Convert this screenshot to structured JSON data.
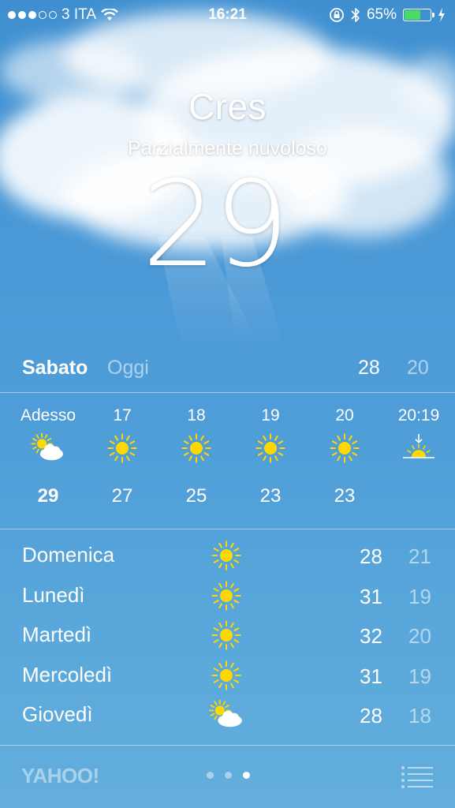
{
  "status_bar": {
    "signal_dots_filled": 3,
    "signal_dots_total": 5,
    "carrier": "3 ITA",
    "time": "16:21",
    "battery_percent_label": "65%",
    "battery_level": 0.65,
    "battery_color": "#4cd964",
    "icons": [
      "wifi-icon",
      "rotation-lock-icon",
      "bluetooth-icon",
      "battery-icon",
      "charging-icon"
    ]
  },
  "location": {
    "city": "Cres",
    "condition": "Parzialmente nuvoloso",
    "temperature": "29"
  },
  "today": {
    "day": "Sabato",
    "label": "Oggi",
    "high": "28",
    "low": "20"
  },
  "hourly": [
    {
      "time": "Adesso",
      "icon": "partly-cloudy-icon",
      "temp": "29"
    },
    {
      "time": "17",
      "icon": "sun-icon",
      "temp": "27"
    },
    {
      "time": "18",
      "icon": "sun-icon",
      "temp": "25"
    },
    {
      "time": "19",
      "icon": "sun-icon",
      "temp": "23"
    },
    {
      "time": "20",
      "icon": "sun-icon",
      "temp": "23"
    },
    {
      "time": "20:19",
      "icon": "sunset-icon",
      "temp": ""
    }
  ],
  "daily": [
    {
      "day": "Domenica",
      "icon": "sun-icon",
      "high": "28",
      "low": "21"
    },
    {
      "day": "Lunedì",
      "icon": "sun-icon",
      "high": "31",
      "low": "19"
    },
    {
      "day": "Martedì",
      "icon": "sun-icon",
      "high": "32",
      "low": "20"
    },
    {
      "day": "Mercoledì",
      "icon": "sun-icon",
      "high": "31",
      "low": "19"
    },
    {
      "day": "Giovedì",
      "icon": "partly-cloudy-icon",
      "high": "28",
      "low": "18"
    }
  ],
  "footer": {
    "logo": "YAHOO!",
    "pages_total": 3,
    "page_current": 3
  },
  "colors": {
    "sun": "#ffd800",
    "sky_top": "#3f8fd0",
    "sky_bottom": "#63aedc"
  }
}
